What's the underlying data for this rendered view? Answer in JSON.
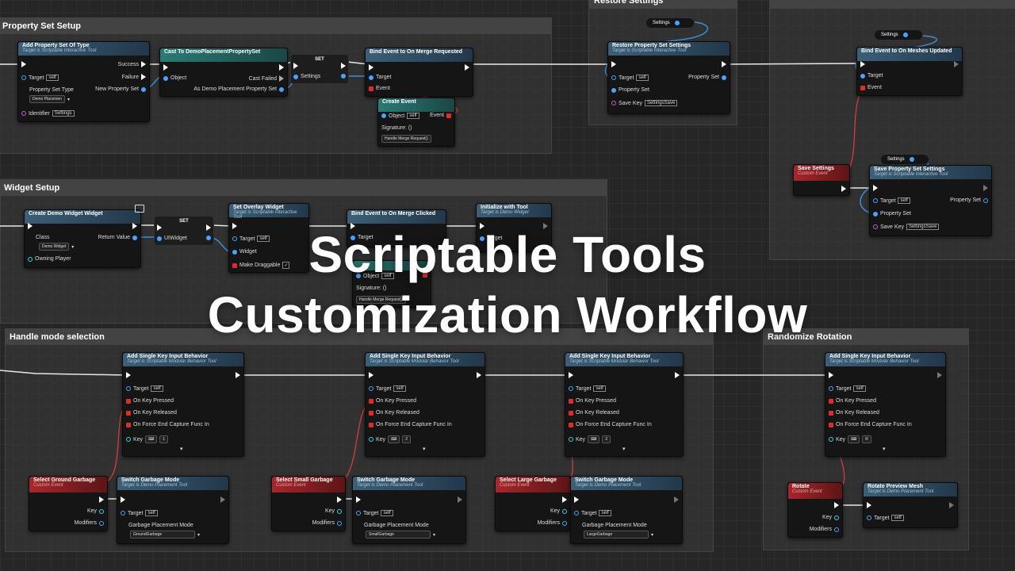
{
  "overlay": {
    "line1": "Scriptable Tools",
    "line2": "Customization Workflow"
  },
  "comments": {
    "property_set_setup": "Property Set Setup",
    "restore_settings": "Restore Settings",
    "widget_setup": "Widget Setup",
    "handle_mode_selection": "Handle mode selection",
    "randomize_rotation": "Randomize Rotation"
  },
  "nodes": {
    "add_property_set": {
      "title": "Add Property Set Of Type",
      "subtitle": "Target is Scriptable Interactive Tool",
      "success": "Success",
      "failure": "Failure",
      "new_property_set": "New Property Set",
      "target": "Target",
      "self": "self",
      "property_set_type": "Property Set Type",
      "type_value": "Demo Placemen",
      "identifier": "Identifier",
      "identifier_value": "Settings"
    },
    "cast_to": {
      "title": "Cast To DemoPlacementPropertySet",
      "object": "Object",
      "cast_failed": "Cast Failed",
      "as_demo": "As Demo Placement Property Set"
    },
    "set_settings": {
      "title": "SET",
      "settings": "Settings"
    },
    "bind_merge": {
      "title": "Bind Event to On Merge Requested",
      "target": "Target",
      "event": "Event"
    },
    "create_event": {
      "title": "Create Event",
      "object": "Object",
      "self": "self",
      "event": "Event",
      "signature": "Signature: ()",
      "handler": "Handle Merge Request()"
    },
    "restore_settings": {
      "title": "Restore Property Set Settings",
      "subtitle": "Target is Scriptable Interactive Tool",
      "target": "Target",
      "self": "self",
      "property_set": "Property Set",
      "save_key": "Save Key",
      "save_key_value": "SettingsSave",
      "out_property_set": "Property Set"
    },
    "var_settings_1": "Settings",
    "var_settings_2": "Settings",
    "var_settings_3": "Settings",
    "bind_meshes": {
      "title": "Bind Event to On Meshes Updated",
      "target": "Target",
      "event": "Event"
    },
    "save_settings_event": {
      "title": "Save Settings",
      "subtitle": "Custom Event"
    },
    "save_property_set": {
      "title": "Save Property Set Settings",
      "subtitle": "Target is Scriptable Interactive Tool",
      "target": "Target",
      "self": "self",
      "property_set": "Property Set",
      "save_key": "Save Key",
      "save_key_value": "SettingsSave",
      "out_property_set": "Property Set"
    },
    "create_widget": {
      "title": "Create Demo Widget Widget",
      "class": "Class",
      "class_value": "Demo Widget",
      "return_value": "Return Value",
      "owning_player": "Owning Player"
    },
    "set_uiwidget": {
      "title": "SET",
      "uiwidget": "UIWidget"
    },
    "set_overlay": {
      "title": "Set Overlay Widget",
      "subtitle": "Target is Scriptable Interactive Tool",
      "target": "Target",
      "self": "self",
      "widget": "Widget",
      "make_draggable": "Make Draggable"
    },
    "bind_clicked": {
      "title": "Bind Event to On Merge Clicked",
      "target": "Target"
    },
    "initialize_tool": {
      "title": "Initialize with Tool",
      "subtitle": "Target is Demo Widget",
      "target": "Target"
    },
    "create_event_2": {
      "object": "Object",
      "self": "self",
      "signature": "Signature: ()",
      "handler": "Handle Merge Request()"
    },
    "add_key_1": {
      "title": "Add Single Key Input Behavior",
      "subtitle": "Target is Scriptable Modular Behavior Tool",
      "target": "Target",
      "self": "self",
      "pressed": "On Key Pressed",
      "released": "On Key Released",
      "force_end": "On Force End Capture Func In",
      "key": "Key",
      "key_value": "1"
    },
    "add_key_2": {
      "title": "Add Single Key Input Behavior",
      "subtitle": "Target is Scriptable Modular Behavior Tool",
      "target": "Target",
      "self": "self",
      "pressed": "On Key Pressed",
      "released": "On Key Released",
      "force_end": "On Force End Capture Func In",
      "key": "Key",
      "key_value": "2"
    },
    "add_key_3": {
      "title": "Add Single Key Input Behavior",
      "subtitle": "Target is Scriptable Modular Behavior Tool",
      "target": "Target",
      "self": "self",
      "pressed": "On Key Pressed",
      "released": "On Key Released",
      "force_end": "On Force End Capture Func In",
      "key": "Key",
      "key_value": "3"
    },
    "add_key_r": {
      "title": "Add Single Key Input Behavior",
      "subtitle": "Target is Scriptable Modular Behavior Tool",
      "target": "Target",
      "self": "self",
      "pressed": "On Key Pressed",
      "released": "On Key Released",
      "force_end": "On Force End Capture Func In",
      "key": "Key",
      "key_value": "R"
    },
    "ev_ground": {
      "title": "Select Ground Garbage",
      "subtitle": "Custom Event",
      "key": "Key",
      "modifiers": "Modifiers"
    },
    "ev_small": {
      "title": "Select Small Garbage",
      "subtitle": "Custom Event",
      "key": "Key",
      "modifiers": "Modifiers"
    },
    "ev_large": {
      "title": "Select Large Garbage",
      "subtitle": "Custom Event",
      "key": "Key",
      "modifiers": "Modifiers"
    },
    "ev_rotate": {
      "title": "Rotate",
      "subtitle": "Custom Event",
      "key": "Key",
      "modifiers": "Modifiers"
    },
    "switch_1": {
      "title": "Switch Garbage Mode",
      "subtitle": "Target is Demo Placement Tool",
      "target": "Target",
      "self": "self",
      "mode_label": "Garbage Placement Mode",
      "mode_value": "GroundGarbage"
    },
    "switch_2": {
      "title": "Switch Garbage Mode",
      "subtitle": "Target is Demo Placement Tool",
      "target": "Target",
      "self": "self",
      "mode_label": "Garbage Placement Mode",
      "mode_value": "SmallGarbage"
    },
    "switch_3": {
      "title": "Switch Garbage Mode",
      "subtitle": "Target is Demo Placement Tool",
      "target": "Target",
      "self": "self",
      "mode_label": "Garbage Placement Mode",
      "mode_value": "LargeGarbage"
    },
    "rotate_preview": {
      "title": "Rotate Preview Mesh",
      "subtitle": "Target is Demo Placement Tool",
      "target": "Target",
      "self": "self"
    }
  }
}
